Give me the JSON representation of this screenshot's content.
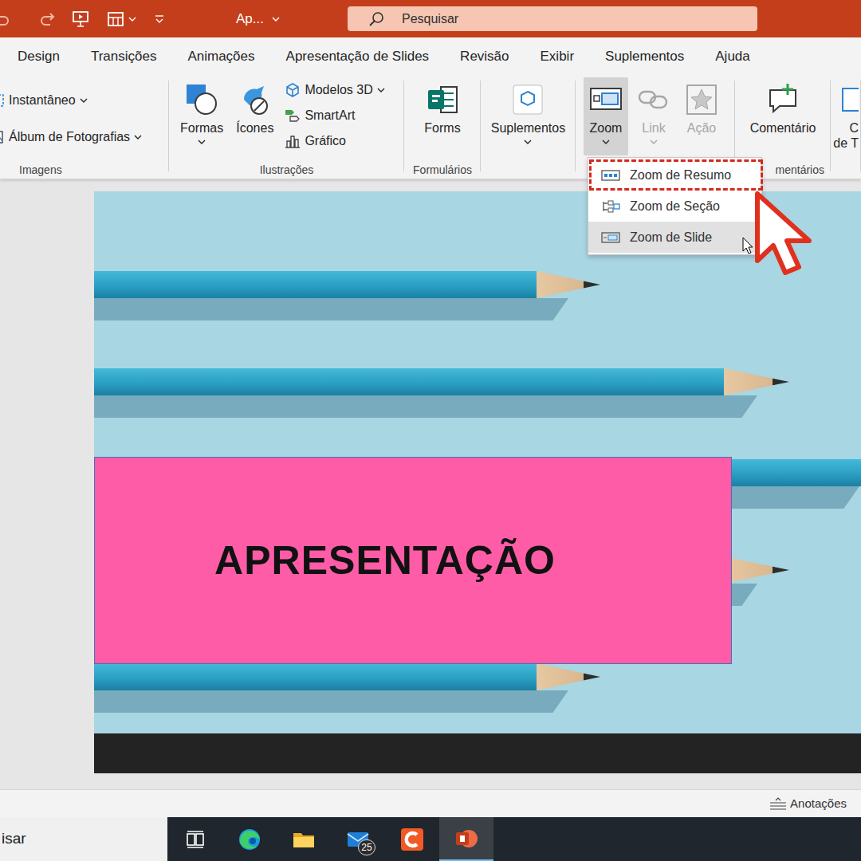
{
  "window": {
    "title": "Ap..."
  },
  "search": {
    "placeholder": "Pesquisar"
  },
  "tabs": [
    {
      "label": "Design",
      "selected": false
    },
    {
      "label": "Transições",
      "selected": false
    },
    {
      "label": "Animações",
      "selected": false
    },
    {
      "label": "Apresentação de Slides",
      "selected": false
    },
    {
      "label": "Revisão",
      "selected": false
    },
    {
      "label": "Exibir",
      "selected": false
    },
    {
      "label": "Suplementos",
      "selected": false
    },
    {
      "label": "Ajuda",
      "selected": false
    }
  ],
  "ribbon": {
    "groups": [
      {
        "label": "Imagens",
        "buttons": [
          {
            "label": "Instantâneo",
            "kind": "small",
            "dropdown": true,
            "pressed": false,
            "disabled": false
          },
          {
            "label": "Álbum de Fotografias",
            "kind": "small",
            "dropdown": true,
            "pressed": false,
            "disabled": false
          }
        ]
      },
      {
        "label": "Ilustrações",
        "buttons": [
          {
            "label": "Formas",
            "kind": "large",
            "dropdown": true,
            "pressed": false,
            "disabled": false
          },
          {
            "label": "Ícones",
            "kind": "large",
            "dropdown": false,
            "pressed": false,
            "disabled": false
          },
          {
            "label": "Modelos 3D",
            "kind": "small",
            "dropdown": true,
            "pressed": false,
            "disabled": false
          },
          {
            "label": "SmartArt",
            "kind": "small",
            "dropdown": false,
            "pressed": false,
            "disabled": false
          },
          {
            "label": "Gráfico",
            "kind": "small",
            "dropdown": false,
            "pressed": false,
            "disabled": false
          }
        ]
      },
      {
        "label": "Formulários",
        "buttons": [
          {
            "label": "Forms",
            "kind": "large",
            "dropdown": false,
            "pressed": false,
            "disabled": false
          }
        ]
      },
      {
        "buttons": [
          {
            "label": "Suplementos",
            "kind": "large",
            "dropdown": true,
            "pressed": false,
            "disabled": false
          }
        ]
      },
      {
        "buttons": [
          {
            "label": "Zoom",
            "kind": "large",
            "dropdown": true,
            "pressed": true,
            "disabled": false
          },
          {
            "label": "Link",
            "kind": "large",
            "dropdown": true,
            "pressed": false,
            "disabled": true
          },
          {
            "label": "Ação",
            "kind": "large",
            "dropdown": false,
            "pressed": false,
            "disabled": true
          }
        ]
      },
      {
        "label": "mentários",
        "buttons": [
          {
            "label": "Comentário",
            "kind": "large",
            "dropdown": false,
            "pressed": false,
            "disabled": false
          }
        ]
      },
      {
        "buttons": [
          {
            "label": "C\nde T",
            "kind": "large",
            "dropdown": false,
            "pressed": false,
            "disabled": false
          }
        ]
      }
    ]
  },
  "zoom_menu": {
    "items": [
      {
        "label": "Zoom de Resumo",
        "annotated": true,
        "hovered": false
      },
      {
        "label": "Zoom de Seção",
        "annotated": false,
        "hovered": false
      },
      {
        "label": "Zoom de Slide",
        "annotated": false,
        "hovered": true
      }
    ]
  },
  "slide": {
    "title": "APRESENTAÇÃO"
  },
  "status_bar": {
    "notes": "Anotações"
  },
  "taskbar": {
    "search": "isar",
    "apps": [
      {
        "kind": "taskview",
        "active": false
      },
      {
        "kind": "edge",
        "active": false
      },
      {
        "kind": "explorer",
        "active": false
      },
      {
        "kind": "mail",
        "active": false,
        "badge": "25"
      },
      {
        "kind": "camtasia",
        "active": false
      },
      {
        "kind": "powerpoint",
        "active": true
      }
    ]
  }
}
